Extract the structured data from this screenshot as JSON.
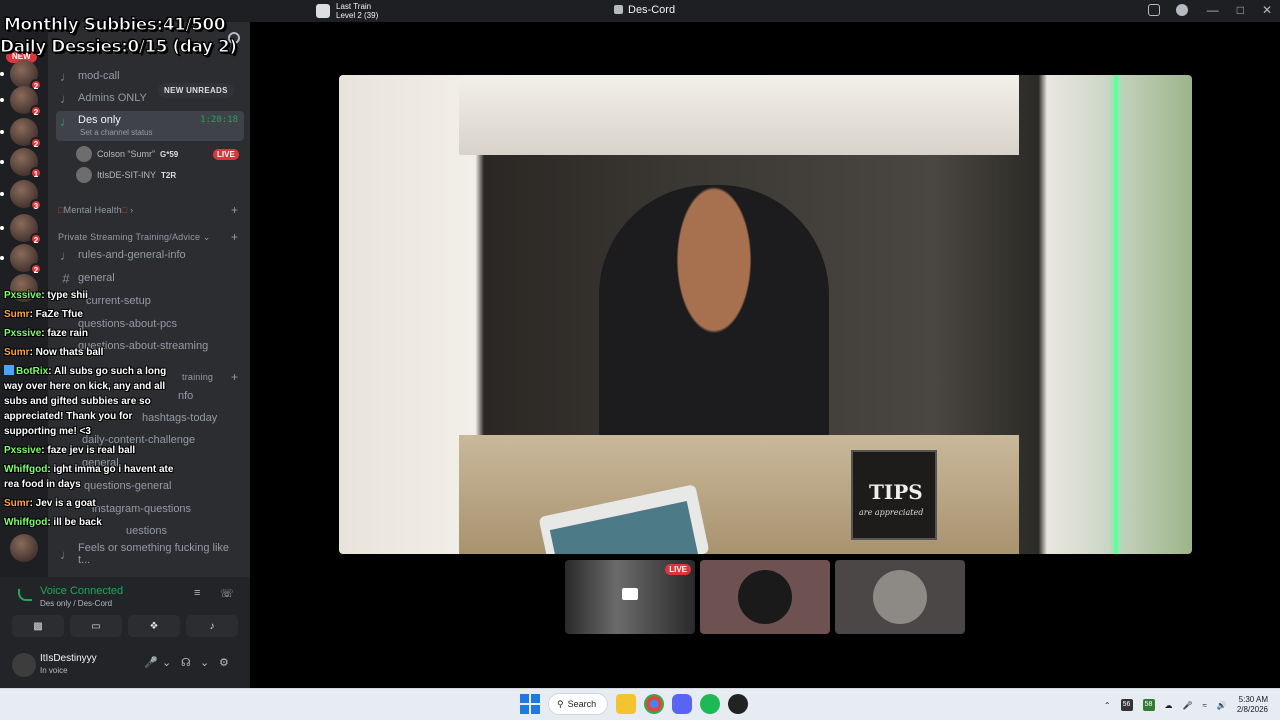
{
  "titlebar": {
    "app_title": "Des-Cord",
    "activity_title": "Last Train",
    "activity_sub": "Level 2  (39)"
  },
  "overlay": {
    "line1": "Monthly Subbies:41/500",
    "line2": "Daily Dessies:0/15 (day 2)"
  },
  "sidebar": {
    "server_name": "Des-Cord",
    "new_unreads": "NEW UNREADS",
    "new_label": "NEW",
    "channels": {
      "mod_call": "mod-call",
      "admins": "Admins ONLY",
      "des_only": "Des only",
      "des_only_timer": "1:20:18",
      "des_only_status": "Set a channel status",
      "mental_health": "Mental Health",
      "private_category": "Private Streaming Training/Advice",
      "rules": "rules-and-general-info",
      "general": "general",
      "current_setup": "current-setup",
      "questions_pcs": "questions-about-pcs",
      "questions_streaming": "questions-about-streaming",
      "training_partial": "training",
      "info_partial": "nfo",
      "hashtags": "hashtags-today",
      "daily_challenge": "daily-content-challenge",
      "general2": "general",
      "questions_general": "questions-general",
      "instagram_questions": "instagram-questions",
      "questions_partial": "uestions",
      "feels": "Feels or something fucking like t..."
    },
    "voice_users": [
      {
        "name": "Colson “Sumr”",
        "tag": "G*59",
        "live": "LIVE"
      },
      {
        "name": "ItIsDE-SIT-INY",
        "tag": "T2R"
      }
    ],
    "server_badges": [
      "2",
      "2",
      "2",
      "1",
      "3",
      "2",
      "2"
    ]
  },
  "chat": [
    {
      "user": "Pxssive",
      "color": "#7dff6a",
      "text": ": type shii"
    },
    {
      "user": "Sumr",
      "color": "#ffa63d",
      "text": ": FaZe Tfue"
    },
    {
      "user": "Pxssive",
      "color": "#7dff6a",
      "text": ": faze rain"
    },
    {
      "user": "Sumr",
      "color": "#ffa63d",
      "text": ": Now thats ball"
    },
    {
      "user": "BotRix",
      "color": "#7dff6a",
      "text": ": All subs go such a long way over here on kick, any and all subs and gifted subbies are so appreciated! Thank you for supporting me! <3"
    },
    {
      "user": "Pxssive",
      "color": "#7dff6a",
      "text": ": faze jev is real ball"
    },
    {
      "user": "Whiffgod",
      "color": "#7dff6a",
      "text": ": ight imma go i havent ate rea food in days"
    },
    {
      "user": "Sumr",
      "color": "#ffa63d",
      "text": ": Jev is a goat"
    },
    {
      "user": "Whiffgod",
      "color": "#7dff6a",
      "text": ": ill be back"
    }
  ],
  "voice": {
    "status": "Voice Connected",
    "location": "Des only / Des-Cord"
  },
  "user": {
    "name": "ItIsDestinyyy",
    "status": "In voice"
  },
  "stream": {
    "tips_title": "TIPS",
    "tips_sub": "are appreciated",
    "tile_live": "LIVE"
  },
  "taskbar": {
    "search": "Search",
    "time": "5:30 AM",
    "date": "2/8/2026",
    "tray1": "56",
    "tray2": "58"
  }
}
